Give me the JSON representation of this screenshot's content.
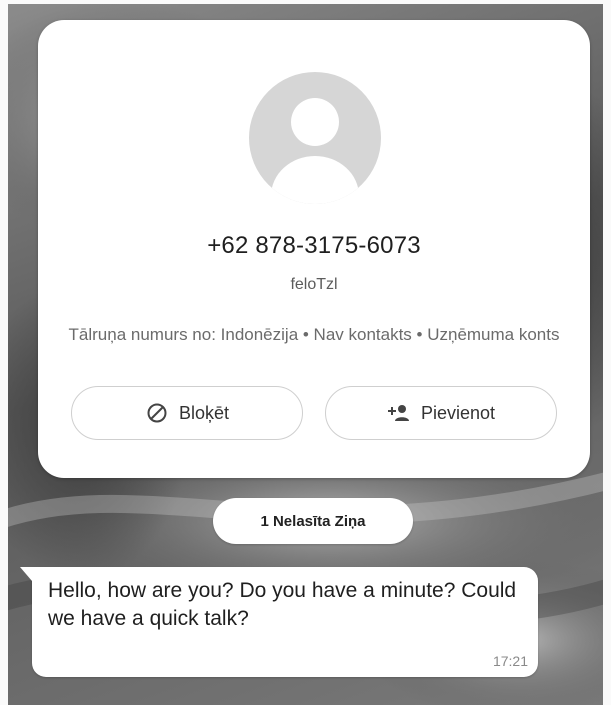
{
  "contact_card": {
    "phone_number": "+62 878-3175-6073",
    "username": "feloTzl",
    "origin_info": "Tālruņa numurs no: Indonēzija • Nav kontakts • Uzņēmuma konts",
    "block_button_label": "Bloķēt",
    "add_button_label": "Pievienot",
    "avatar_icon": "default-person-icon",
    "block_icon": "block-circle-icon",
    "add_icon": "person-add-icon"
  },
  "unread_banner": {
    "label": "1 Nelasīta Ziņa"
  },
  "message": {
    "text": "Hello, how are you? Do you have a minute? Could we have a quick talk?",
    "time": "17:21"
  },
  "colors": {
    "card_background": "#ffffff",
    "avatar_background": "#d6d6d6",
    "wallpaper": "#6f6f6f"
  }
}
